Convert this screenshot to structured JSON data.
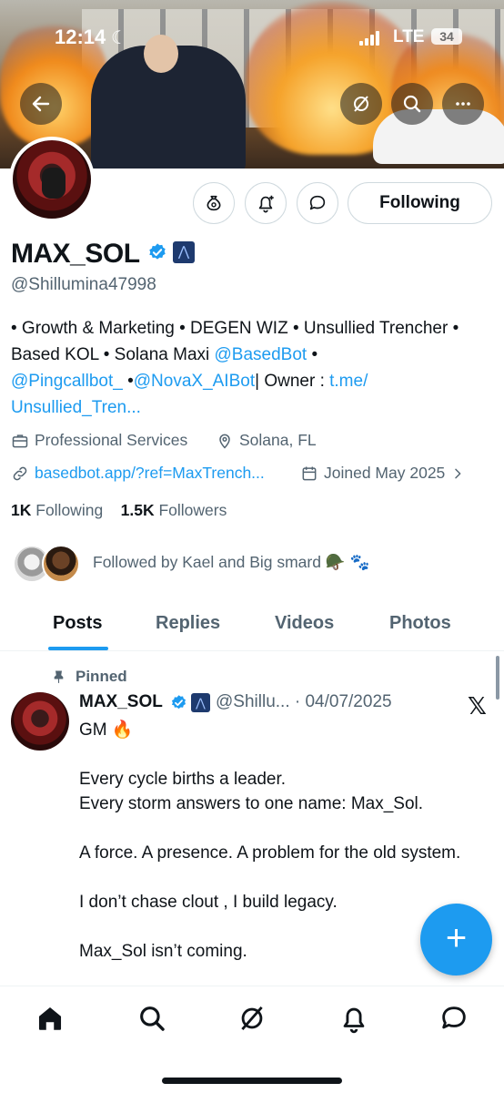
{
  "status_bar": {
    "time": "12:14",
    "network": "LTE",
    "battery": "34"
  },
  "profile": {
    "name": "MAX_SOL",
    "handle": "@Shillumina47998",
    "follow_button": "Following",
    "bio_text_1": "• Growth & Marketing • DEGEN WIZ • Unsullied Trencher • Based KOL • Solana Maxi ",
    "bio_link_1": "@BasedBot",
    "bio_text_2": " • ",
    "bio_link_2": "@Pingcallbot_",
    "bio_text_3": " •",
    "bio_link_3": "@NovaX_AIBot",
    "bio_text_4": "| Owner : ",
    "bio_link_4": "t.me/ Unsullied_Tren...",
    "category": "Professional Services",
    "location": "Solana, FL",
    "website": "basedbot.app/?ref=MaxTrench...",
    "joined": "Joined May 2025",
    "following_count": "1K",
    "following_label": "Following",
    "followers_count": "1.5K",
    "followers_label": "Followers",
    "followed_by": "Followed by Kael and Big smard 🪖 🐾"
  },
  "tabs": [
    "Posts",
    "Replies",
    "Videos",
    "Photos"
  ],
  "active_tab": "Posts",
  "pinned_post": {
    "pinned_label": "Pinned",
    "author": "MAX_SOL",
    "handle_date": "@Shillu... · 04/07/2025",
    "body": "GM 🔥\n\nEvery cycle births a leader.\nEvery storm answers to one name: Max_Sol.\n\nA force. A presence. A problem for the old system.\n\nI don’t chase clout , I build legacy.\n\nMax_Sol isn’t coming."
  },
  "fab_label": "+",
  "colors": {
    "accent": "#1d9bf0",
    "text": "#0f1419",
    "secondary": "#536471"
  }
}
